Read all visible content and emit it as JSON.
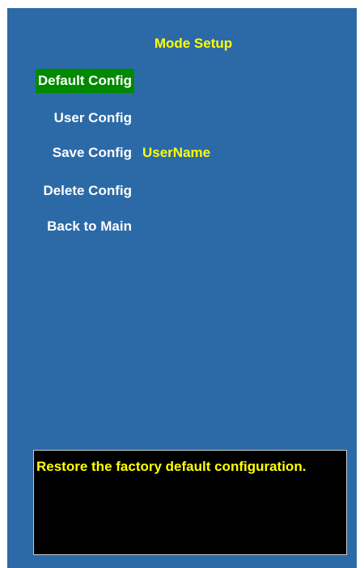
{
  "screen": {
    "title": "Mode Setup",
    "menu": [
      {
        "label": "Default Config",
        "selected": true
      },
      {
        "label": "User Config",
        "selected": false
      },
      {
        "label": "Save Config",
        "selected": false
      },
      {
        "label": "Delete Config",
        "selected": false
      },
      {
        "label": "Back to Main",
        "selected": false
      }
    ],
    "save_config_value": "UserName",
    "help_text": "Restore the factory default configuration."
  },
  "colors": {
    "background": "#2c6aa7",
    "title_text": "#ffff00",
    "selected_highlight": "#008a00",
    "help_box_bg": "#000000",
    "help_text": "#ffff00"
  }
}
